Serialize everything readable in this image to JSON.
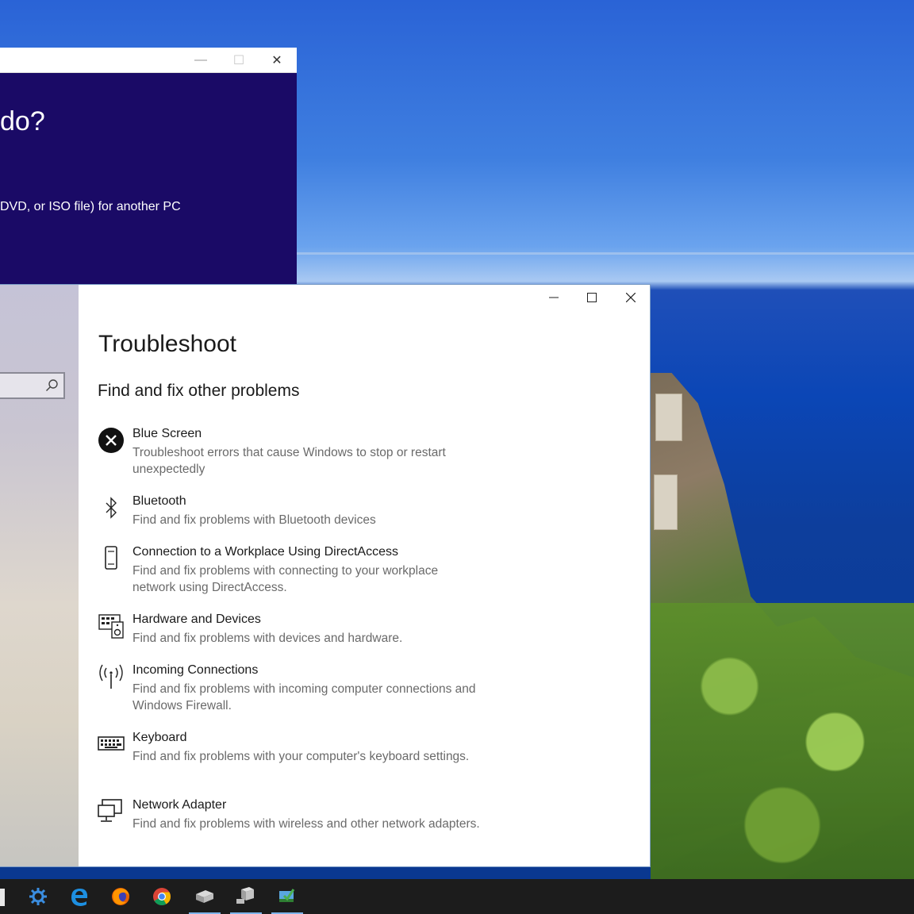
{
  "media_window": {
    "heading_fragment": "do?",
    "option_fragment": "DVD, or ISO file) for another PC"
  },
  "settings": {
    "page_title": "Troubleshoot",
    "section_title": "Find and fix other problems",
    "items": [
      {
        "icon": "blue-screen-icon",
        "name": "Blue Screen",
        "desc": "Troubleshoot errors that cause Windows to stop or restart unexpectedly"
      },
      {
        "icon": "bluetooth-icon",
        "name": "Bluetooth",
        "desc": "Find and fix problems with Bluetooth devices"
      },
      {
        "icon": "phone-device-icon",
        "name": "Connection to a Workplace Using DirectAccess",
        "desc": "Find and fix problems with connecting to your workplace network using DirectAccess."
      },
      {
        "icon": "hardware-devices-icon",
        "name": "Hardware and Devices",
        "desc": "Find and fix problems with devices and hardware."
      },
      {
        "icon": "antenna-icon",
        "name": "Incoming Connections",
        "desc": "Find and fix problems with incoming computer connections and Windows Firewall."
      },
      {
        "icon": "keyboard-icon",
        "name": "Keyboard",
        "desc": "Find and fix problems with your computer's keyboard settings."
      },
      {
        "icon": "network-adapter-icon",
        "name": "Network Adapter",
        "desc": "Find and fix problems with wireless and other network adapters."
      }
    ]
  },
  "taskbar": {
    "apps": [
      {
        "icon": "settings-gear-app-icon",
        "active": false
      },
      {
        "icon": "edge-browser-icon",
        "active": false
      },
      {
        "icon": "firefox-icon",
        "active": false
      },
      {
        "icon": "chrome-icon",
        "active": false
      },
      {
        "icon": "drive-app-icon",
        "active": true
      },
      {
        "icon": "network-drive-app-icon",
        "active": true
      },
      {
        "icon": "media-creation-app-icon",
        "active": true
      }
    ]
  },
  "colors": {
    "media_bg": "#1a0a66",
    "taskbar_bg": "#1c1c1c",
    "accent": "#7eb4ea"
  }
}
